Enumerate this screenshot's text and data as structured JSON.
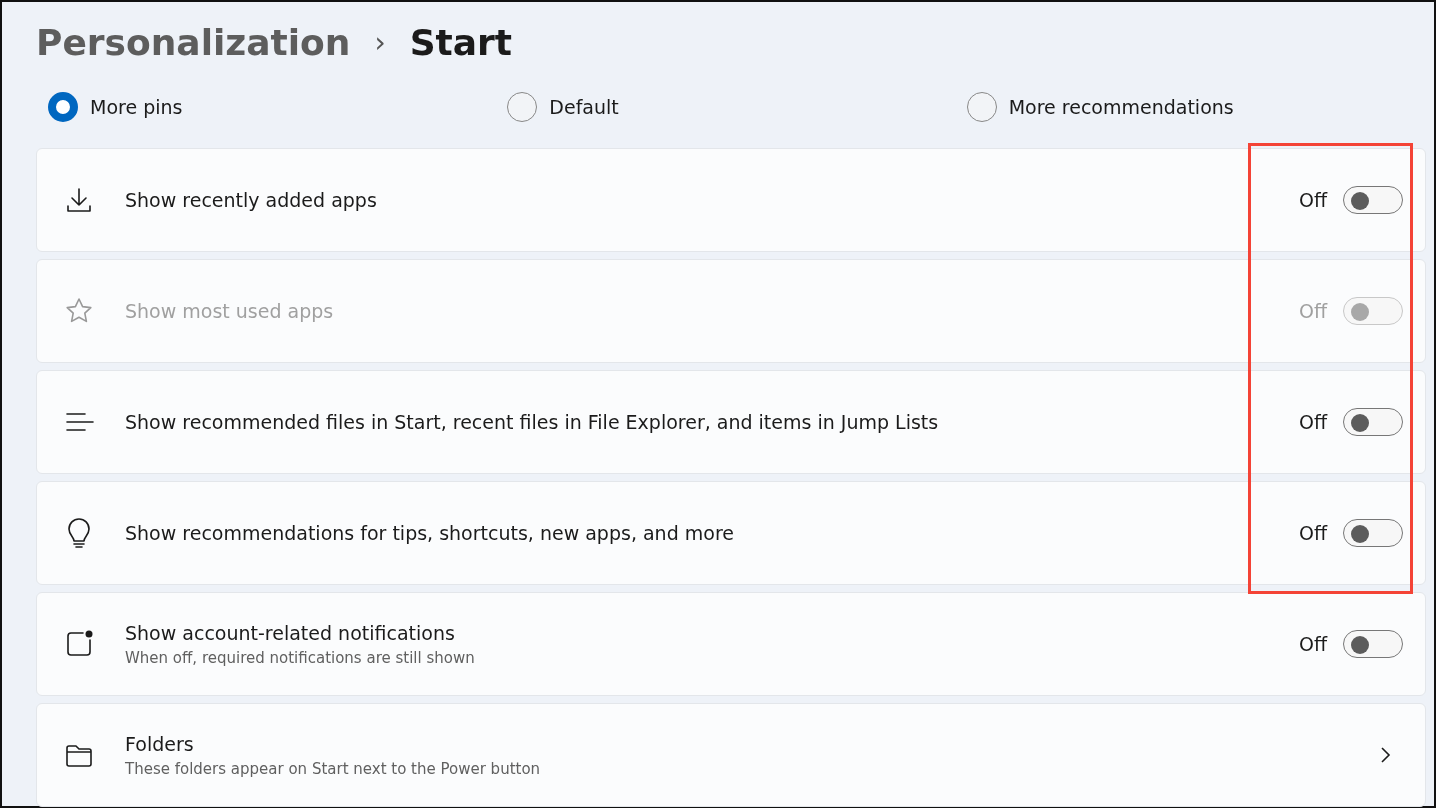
{
  "breadcrumb": {
    "parent": "Personalization",
    "separator": "›",
    "current": "Start"
  },
  "layout_options": [
    {
      "label": "More pins",
      "selected": true
    },
    {
      "label": "Default",
      "selected": false
    },
    {
      "label": "More recommendations",
      "selected": false
    }
  ],
  "settings": [
    {
      "kind": "toggle",
      "label": "Show recently added apps",
      "state_text": "Off",
      "on": false,
      "disabled": false,
      "highlighted": true
    },
    {
      "kind": "toggle",
      "label": "Show most used apps",
      "state_text": "Off",
      "on": false,
      "disabled": true,
      "highlighted": true
    },
    {
      "kind": "toggle",
      "label": "Show recommended files in Start, recent files in File Explorer, and items in Jump Lists",
      "state_text": "Off",
      "on": false,
      "disabled": false,
      "highlighted": true
    },
    {
      "kind": "toggle",
      "label": "Show recommendations for tips, shortcuts, new apps, and more",
      "state_text": "Off",
      "on": false,
      "disabled": false,
      "highlighted": true
    },
    {
      "kind": "toggle",
      "label": "Show account-related notifications",
      "description": "When off, required notifications are still shown",
      "state_text": "Off",
      "on": false,
      "disabled": false,
      "highlighted": false
    },
    {
      "kind": "link",
      "label": "Folders",
      "description": "These folders appear on Start next to the Power button",
      "highlighted": false
    }
  ]
}
